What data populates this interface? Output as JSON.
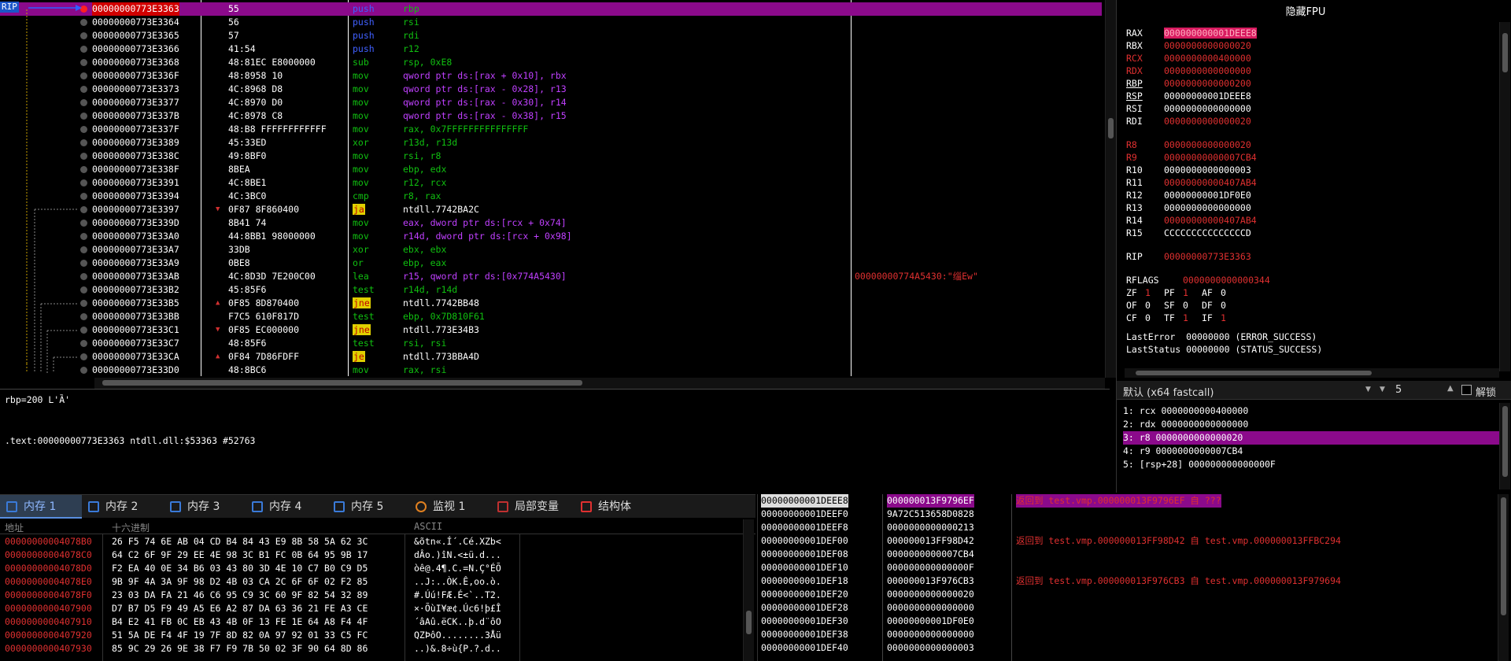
{
  "disasm": {
    "rip_label": "RIP",
    "rows": [
      {
        "addr": "00000000773E3363",
        "bytes": "55",
        "mn": "push",
        "op": "rbp",
        "cm": ""
      },
      {
        "addr": "00000000773E3364",
        "bytes": "56",
        "mn": "push",
        "op": "rsi",
        "cm": ""
      },
      {
        "addr": "00000000773E3365",
        "bytes": "57",
        "mn": "push",
        "op": "rdi",
        "cm": ""
      },
      {
        "addr": "00000000773E3366",
        "bytes": "41:54",
        "mn": "push",
        "op": "r12",
        "cm": ""
      },
      {
        "addr": "00000000773E3368",
        "bytes": "48:81EC E8000000",
        "mn": "sub",
        "op": "rsp, 0xE8",
        "cm": ""
      },
      {
        "addr": "00000000773E336F",
        "bytes": "48:8958 10",
        "mn": "mov",
        "op": "qword ptr ds:[rax + 0x10], rbx",
        "cm": ""
      },
      {
        "addr": "00000000773E3373",
        "bytes": "4C:8968 D8",
        "mn": "mov",
        "op": "qword ptr ds:[rax - 0x28], r13",
        "cm": ""
      },
      {
        "addr": "00000000773E3377",
        "bytes": "4C:8970 D0",
        "mn": "mov",
        "op": "qword ptr ds:[rax - 0x30], r14",
        "cm": ""
      },
      {
        "addr": "00000000773E337B",
        "bytes": "4C:8978 C8",
        "mn": "mov",
        "op": "qword ptr ds:[rax - 0x38], r15",
        "cm": ""
      },
      {
        "addr": "00000000773E337F",
        "bytes": "48:B8 FFFFFFFFFFFF",
        "mn": "mov",
        "op": "rax, 0x7FFFFFFFFFFFFFFF",
        "cm": ""
      },
      {
        "addr": "00000000773E3389",
        "bytes": "45:33ED",
        "mn": "xor",
        "op": "r13d, r13d",
        "cm": ""
      },
      {
        "addr": "00000000773E338C",
        "bytes": "49:8BF0",
        "mn": "mov",
        "op": "rsi, r8",
        "cm": ""
      },
      {
        "addr": "00000000773E338F",
        "bytes": "8BEA",
        "mn": "mov",
        "op": "ebp, edx",
        "cm": ""
      },
      {
        "addr": "00000000773E3391",
        "bytes": "4C:8BE1",
        "mn": "mov",
        "op": "r12, rcx",
        "cm": ""
      },
      {
        "addr": "00000000773E3394",
        "bytes": "4C:3BC0",
        "mn": "cmp",
        "op": "r8, rax",
        "cm": ""
      },
      {
        "addr": "00000000773E3397",
        "bytes": "0F87 8F860400",
        "mn": "ja",
        "op": "ntdll.7742BA2C",
        "cm": ""
      },
      {
        "addr": "00000000773E339D",
        "bytes": "8B41 74",
        "mn": "mov",
        "op": "eax, dword ptr ds:[rcx + 0x74]",
        "cm": ""
      },
      {
        "addr": "00000000773E33A0",
        "bytes": "44:8BB1 98000000",
        "mn": "mov",
        "op": "r14d, dword ptr ds:[rcx + 0x98]",
        "cm": ""
      },
      {
        "addr": "00000000773E33A7",
        "bytes": "33DB",
        "mn": "xor",
        "op": "ebx, ebx",
        "cm": ""
      },
      {
        "addr": "00000000773E33A9",
        "bytes": "0BE8",
        "mn": "or",
        "op": "ebp, eax",
        "cm": ""
      },
      {
        "addr": "00000000773E33AB",
        "bytes": "4C:8D3D 7E200C00",
        "mn": "lea",
        "op": "r15, qword ptr ds:[0x774A5430]",
        "cm": "00000000774A5430:\"缁Ew\""
      },
      {
        "addr": "00000000773E33B2",
        "bytes": "45:85F6",
        "mn": "test",
        "op": "r14d, r14d",
        "cm": ""
      },
      {
        "addr": "00000000773E33B5",
        "bytes": "0F85 8D870400",
        "mn": "jne",
        "op": "ntdll.7742BB48",
        "cm": ""
      },
      {
        "addr": "00000000773E33BB",
        "bytes": "F7C5 610F817D",
        "mn": "test",
        "op": "ebp, 0x7D810F61",
        "cm": ""
      },
      {
        "addr": "00000000773E33C1",
        "bytes": "0F85 EC000000",
        "mn": "jne",
        "op": "ntdll.773E34B3",
        "cm": ""
      },
      {
        "addr": "00000000773E33C7",
        "bytes": "48:85F6",
        "mn": "test",
        "op": "rsi, rsi",
        "cm": ""
      },
      {
        "addr": "00000000773E33CA",
        "bytes": "0F84 7D86FDFF",
        "mn": "je",
        "op": "ntdll.773BBA4D",
        "cm": ""
      },
      {
        "addr": "00000000773E33D0",
        "bytes": "48:8BC6",
        "mn": "mov",
        "op": "rax, rsi",
        "cm": ""
      }
    ]
  },
  "info": {
    "line1": "rbp=200 L'Ȁ'",
    "line2": ".text:00000000773E3363 ntdll.dll:$53363 #52763"
  },
  "registers": {
    "title": "隐藏FPU",
    "gp": [
      {
        "name": "RAX",
        "val": "000000000001DEEE8"
      },
      {
        "name": "RBX",
        "val": "0000000000000020"
      },
      {
        "name": "RCX",
        "val": "0000000000400000"
      },
      {
        "name": "RDX",
        "val": "0000000000000000"
      },
      {
        "name": "RBP",
        "val": "0000000000000200"
      },
      {
        "name": "RSP",
        "val": "00000000001DEEE8"
      },
      {
        "name": "RSI",
        "val": "0000000000000000"
      },
      {
        "name": "RDI",
        "val": "0000000000000020"
      }
    ],
    "ext": [
      {
        "name": "R8",
        "val": "0000000000000020"
      },
      {
        "name": "R9",
        "val": "00000000000007CB4"
      },
      {
        "name": "R10",
        "val": "0000000000000003"
      },
      {
        "name": "R11",
        "val": "00000000000407AB4"
      },
      {
        "name": "R12",
        "val": "00000000001DF0E0"
      },
      {
        "name": "R13",
        "val": "0000000000000000"
      },
      {
        "name": "R14",
        "val": "00000000000407AB4"
      },
      {
        "name": "R15",
        "val": "CCCCCCCCCCCCCCCD"
      }
    ],
    "rip": {
      "name": "RIP",
      "val": "00000000773E3363"
    },
    "rflags": {
      "name": "RFLAGS",
      "val": "0000000000000344"
    },
    "flags1": [
      "ZF",
      "1",
      "PF",
      "1",
      "AF",
      "0"
    ],
    "flags2": [
      "OF",
      "0",
      "SF",
      "0",
      "DF",
      "0"
    ],
    "flags3": [
      "CF",
      "0",
      "TF",
      "1",
      "IF",
      "1"
    ],
    "lasterror": "LastError  00000000 (ERROR_SUCCESS)",
    "laststatus": "LastStatus 00000000 (STATUS_SUCCESS)"
  },
  "callconv": {
    "select": "默认 (x64 fastcall)",
    "count": "5",
    "unlock": "解锁",
    "args": [
      "1: rcx 0000000000400000",
      "2: rdx 0000000000000000",
      "3: r8 0000000000000020",
      "4: r9 0000000000007CB4",
      "5: [rsp+28] 000000000000000F"
    ]
  },
  "tabs": [
    "内存 1",
    "内存 2",
    "内存 3",
    "内存 4",
    "内存 5",
    "监视 1",
    "局部变量",
    "结构体"
  ],
  "hex": {
    "h_addr": "地址",
    "h_hex": "十六进制",
    "h_ascii": "ASCII",
    "rows": [
      {
        "a": "00000000004078B0",
        "b": "26 F5 74 6E AB 04 CD B4 84 43 E9 8B 58 5A 62 3C",
        "c": "&õtn«.Í´.Cé.XZb<"
      },
      {
        "a": "00000000004078C0",
        "b": "64 C2 6F 9F 29 EE 4E 98 3C B1 FC 0B 64 95 9B 17",
        "c": "dÂo.)îN.<±ü.d..."
      },
      {
        "a": "00000000004078D0",
        "b": "F2 EA 40 0E 34 B6 03 43 80 3D 4E 10 C7 B0 C9 D5",
        "c": "òê@.4¶.C.=N.Ç°ÉÕ"
      },
      {
        "a": "00000000004078E0",
        "b": "9B 9F 4A 3A 9F 98 D2 4B 03 CA 2C 6F 6F 02 F2 85",
        "c": "..J:..ÒK.Ê,oo.ò."
      },
      {
        "a": "00000000004078F0",
        "b": "23 03 DA FA 21 46 C6 95 C9 3C 60 9F 82 54 32 89",
        "c": "#.Úú!FÆ.É<`..T2."
      },
      {
        "a": "0000000000407900",
        "b": "D7 B7 D5 F9 49 A5 E6 A2 87 DA 63 36 21 FE A3 CE",
        "c": "×·ÕùI¥æ¢.Úc6!þ£Î"
      },
      {
        "a": "0000000000407910",
        "b": "B4 E2 41 FB 0C EB 43 4B 0F 13 FE 1E 64 A8 F4 4F",
        "c": "´âAû.ëCK..þ.d¨ôO"
      },
      {
        "a": "0000000000407920",
        "b": "51 5A DE F4 4F 19 7F 8D 82 0A 97 92 01 33 C5 FC",
        "c": "QZÞôO........3Åü"
      },
      {
        "a": "0000000000407930",
        "b": "85 9C 29 26 9E 38 F7 F9 7B 50 02 3F 90 64 8D 86",
        "c": "..)&.8÷ù{P.?.d.."
      }
    ]
  },
  "stack": {
    "rows": [
      {
        "a": "00000000001DEEE8",
        "v": "000000013F9796EF",
        "c": "返回到 test.vmp.000000013F9796EF 自 ???"
      },
      {
        "a": "00000000001DEEF0",
        "v": "9A72C513658D0828",
        "c": ""
      },
      {
        "a": "00000000001DEEF8",
        "v": "0000000000000213",
        "c": ""
      },
      {
        "a": "00000000001DEF00",
        "v": "000000013FF98D42",
        "c": "返回到 test.vmp.000000013FF98D42 自 test.vmp.000000013FFBC294"
      },
      {
        "a": "00000000001DEF08",
        "v": "0000000000007CB4",
        "c": ""
      },
      {
        "a": "00000000001DEF10",
        "v": "000000000000000F",
        "c": ""
      },
      {
        "a": "00000000001DEF18",
        "v": "000000013F976CB3",
        "c": "返回到 test.vmp.000000013F976CB3 自 test.vmp.000000013F979694"
      },
      {
        "a": "00000000001DEF20",
        "v": "0000000000000020",
        "c": ""
      },
      {
        "a": "00000000001DEF28",
        "v": "0000000000000000",
        "c": ""
      },
      {
        "a": "00000000001DEF30",
        "v": "00000000001DF0E0",
        "c": ""
      },
      {
        "a": "00000000001DEF38",
        "v": "0000000000000000",
        "c": ""
      },
      {
        "a": "00000000001DEF40",
        "v": "0000000000000003",
        "c": ""
      }
    ]
  }
}
